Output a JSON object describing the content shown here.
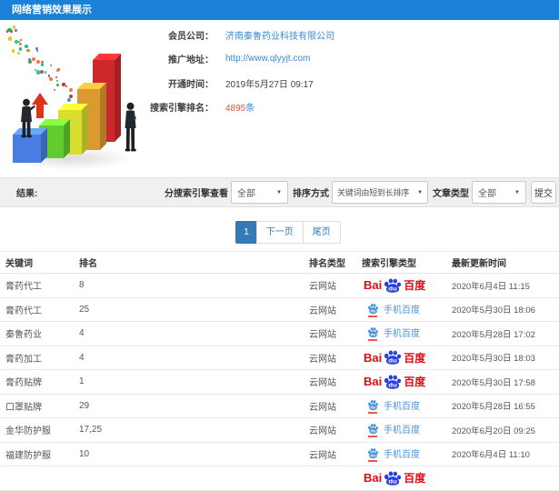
{
  "window": {
    "title": "网络营销效果展示"
  },
  "account": {
    "member_label": "会员公司：",
    "member_value": "济南秦鲁药业科技有限公司",
    "url_label": "推广地址：",
    "url_value": "http://www.qlyyjt.com",
    "open_label": "开通时间：",
    "open_value": "2019年5月27日 09:17",
    "rank_label": "搜索引擎排名：",
    "rank_count": "4895",
    "rank_unit": "条"
  },
  "filters": {
    "result_label": "结果:",
    "engine_label": "分搜索引擎查看",
    "engine_value": "全部",
    "sort_label": "排序方式",
    "sort_value": "关键词由短到长排序",
    "type_label": "文章类型",
    "type_value": "全部",
    "submit_label": "提交"
  },
  "pagination": {
    "current": "1",
    "next": "下一页",
    "last": "尾页"
  },
  "table": {
    "headers": [
      "关键词",
      "排名",
      "排名类型",
      "搜索引擎类型",
      "最新更新时间"
    ],
    "engine_labels": {
      "bai": "Bai",
      "du": "du",
      "cn": "百度",
      "mobile": "手机百度"
    },
    "rows": [
      {
        "keyword": "膏药代工",
        "rank": "8",
        "rank_type": "云网站",
        "engine": "baidu",
        "updated": "2020年6月4日 11:15"
      },
      {
        "keyword": "膏药代工",
        "rank": "25",
        "rank_type": "云网站",
        "engine": "mobile",
        "updated": "2020年5月30日 18:06"
      },
      {
        "keyword": "秦鲁药业",
        "rank": "4",
        "rank_type": "云网站",
        "engine": "mobile",
        "updated": "2020年5月28日 17:02"
      },
      {
        "keyword": "膏药加工",
        "rank": "4",
        "rank_type": "云网站",
        "engine": "baidu",
        "updated": "2020年5月30日 18:03"
      },
      {
        "keyword": "膏药贴牌",
        "rank": "1",
        "rank_type": "云网站",
        "engine": "baidu",
        "updated": "2020年5月30日 17:58"
      },
      {
        "keyword": "口罩贴牌",
        "rank": "29",
        "rank_type": "云网站",
        "engine": "mobile",
        "updated": "2020年5月28日 16:55"
      },
      {
        "keyword": "金华防护服",
        "rank": "17,25",
        "rank_type": "云网站",
        "engine": "mobile",
        "updated": "2020年6月20日 09:25"
      },
      {
        "keyword": "福建防护服",
        "rank": "10",
        "rank_type": "云网站",
        "engine": "mobile",
        "updated": "2020年6月4日 11:10"
      },
      {
        "keyword": "",
        "rank": "",
        "rank_type": "",
        "engine": "baidu",
        "updated": ""
      }
    ]
  }
}
